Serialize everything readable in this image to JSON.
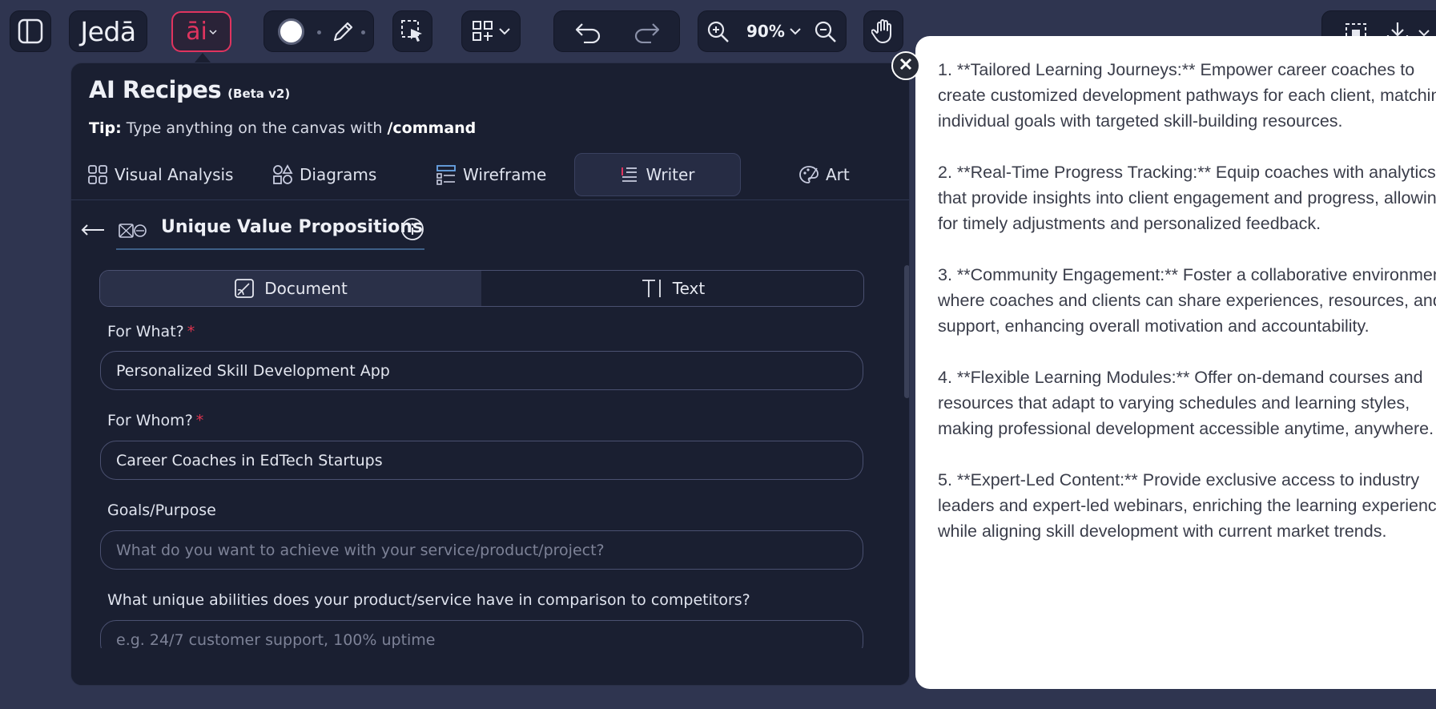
{
  "toolbar": {
    "brand": "Jedā",
    "ai_label": "āi",
    "zoom_level": "90%"
  },
  "panel": {
    "title": "AI Recipes",
    "badge": "(Beta v2)",
    "tip_label": "Tip:",
    "tip_text": "Type anything on the canvas with",
    "tip_command": "/command",
    "tabs": [
      {
        "label": "Visual Analysis",
        "icon": "grid-icon"
      },
      {
        "label": "Diagrams",
        "icon": "shapes-icon"
      },
      {
        "label": "Wireframe",
        "icon": "wireframe-icon"
      },
      {
        "label": "Writer",
        "icon": "text-lines-icon",
        "active": true
      },
      {
        "label": "Art",
        "icon": "palette-icon"
      }
    ]
  },
  "recipe": {
    "title": "Unique Value Propositions",
    "output_modes": [
      {
        "label": "Document",
        "icon": "document-icon",
        "active": true
      },
      {
        "label": "Text",
        "icon": "text-cursor-icon",
        "active": false
      }
    ],
    "fields": [
      {
        "label": "For What?",
        "required": true,
        "value": "Personalized Skill Development App",
        "placeholder": ""
      },
      {
        "label": "For Whom?",
        "required": true,
        "value": "Career Coaches in EdTech Startups",
        "placeholder": ""
      },
      {
        "label": "Goals/Purpose",
        "required": false,
        "value": "",
        "placeholder": "What do you want to achieve with your service/product/project?"
      },
      {
        "label": "What unique abilities does your product/service have in comparison to competitors?",
        "required": false,
        "value": "",
        "placeholder": "e.g. 24/7 customer support, 100% uptime"
      }
    ],
    "required_mark": "*"
  },
  "document": {
    "paragraphs": [
      "1. **Tailored Learning Journeys:** Empower career coaches to create customized development pathways for each client, matching individual goals with targeted skill-building resources.",
      "2. **Real-Time Progress Tracking:** Equip coaches with analytics that provide insights into client engagement and progress, allowing for timely adjustments and personalized feedback.",
      "3. **Community Engagement:** Foster a collaborative environment where coaches and clients can share experiences, resources, and support, enhancing overall motivation and accountability.",
      "4. **Flexible Learning Modules:** Offer on-demand courses and resources that adapt to varying schedules and learning styles, making professional development accessible anytime, anywhere.",
      "5. **Expert-Led Content:** Provide exclusive access to industry leaders and expert-led webinars, enriching the learning experience while aligning skill development with current market trends."
    ]
  },
  "colors": {
    "background": "#2f3550",
    "panel": "#1a1f31",
    "accent_pink": "#e0345f",
    "required_red": "#e0344f"
  }
}
